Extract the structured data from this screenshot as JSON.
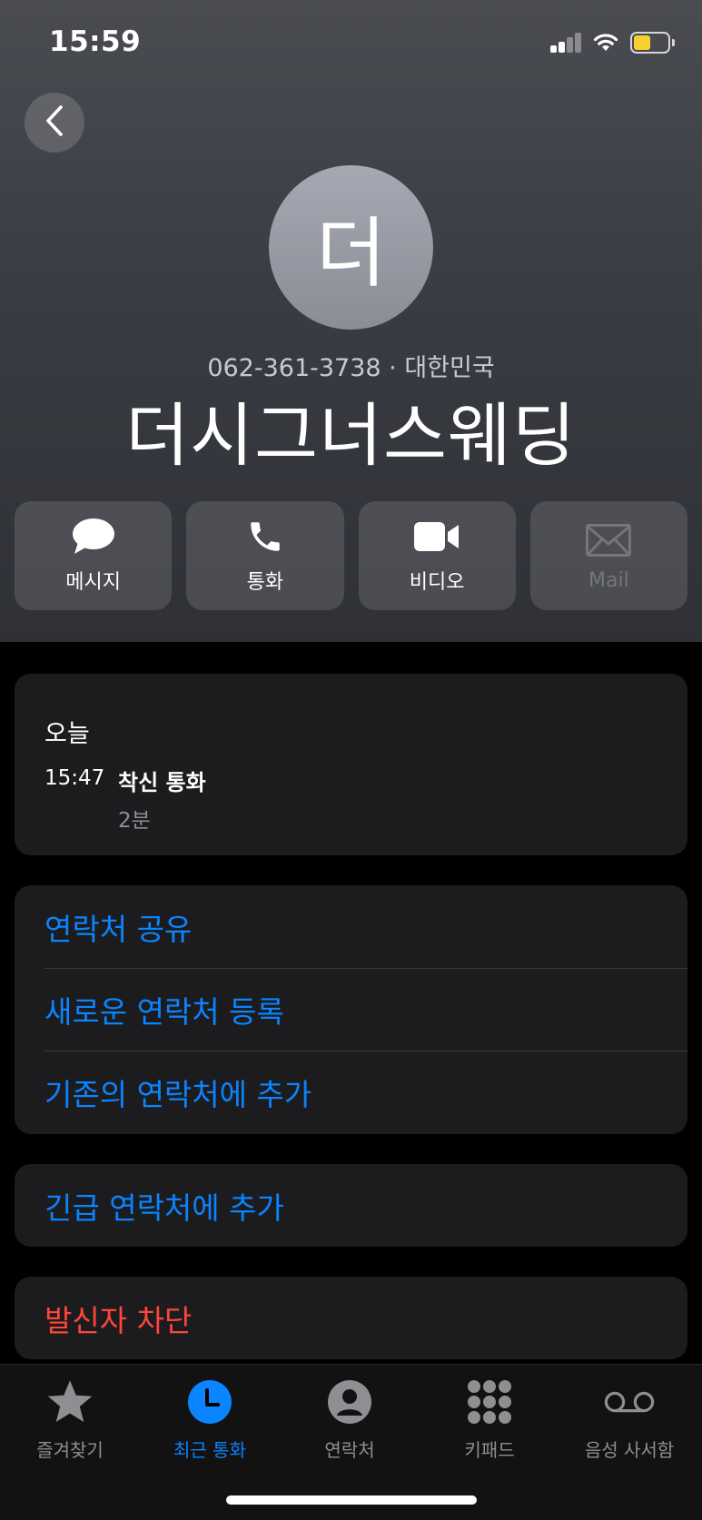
{
  "status_bar": {
    "time": "15:59"
  },
  "contact": {
    "avatar_initial": "더",
    "subtitle": "062-361-3738 · 대한민국",
    "name": "더시그너스웨딩"
  },
  "actions": {
    "message": "메시지",
    "call": "통화",
    "video": "비디오",
    "mail": "Mail"
  },
  "recent": {
    "day": "오늘",
    "time": "15:47",
    "type": "착신 통화",
    "duration": "2분"
  },
  "options": {
    "share_contact": "연락처 공유",
    "create_new_contact": "새로운 연락처 등록",
    "add_to_existing": "기존의 연락처에 추가",
    "add_emergency": "긴급 연락처에 추가",
    "block_caller": "발신자 차단"
  },
  "tabs": {
    "favorites": "즐겨찾기",
    "recents": "최근 통화",
    "contacts": "연락처",
    "keypad": "키패드",
    "voicemail": "음성 사서함"
  },
  "colors": {
    "accent": "#0a84ff",
    "destructive": "#ff453a",
    "battery": "#f8d12f"
  }
}
